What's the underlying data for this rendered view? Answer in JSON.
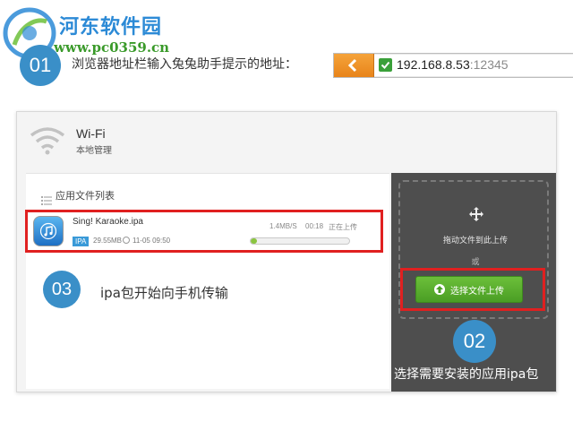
{
  "watermark": {
    "site_name": "河东软件园",
    "site_url": "www.pc0359.cn"
  },
  "step1": {
    "number": "01",
    "text": "浏览器地址栏输入兔兔助手提示的地址："
  },
  "address_bar": {
    "host": "192.168.8.53",
    "port": ":12345"
  },
  "panel": {
    "wifi_title": "Wi-Fi",
    "wifi_subtitle": "本地管理",
    "list_header": "应用文件列表"
  },
  "item": {
    "name": "Sing! Karaoke.ipa",
    "type_badge": "IPA",
    "size": "29.55MB",
    "time": "11-05 09:50",
    "speed": "1.4MB/S",
    "elapsed": "00:18",
    "status": "正在上传",
    "progress_fraction": 0.04
  },
  "step3": {
    "number": "03",
    "text": "ipa包开始向手机传输"
  },
  "upload": {
    "drop_text": "拖动文件到此上传",
    "or_text": "或",
    "button_label": "选择文件上传"
  },
  "step2": {
    "number": "02",
    "text": "选择需要安装的应用ipa包"
  },
  "colors": {
    "step_circle": "#3a8fc8",
    "highlight_frame": "#e02020",
    "upload_button": "#5aae2e",
    "dark_panel": "#4e4e4e",
    "back_button": "#ee9227"
  }
}
